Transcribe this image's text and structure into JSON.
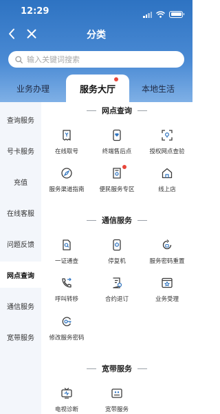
{
  "status": {
    "time": "12:29"
  },
  "nav": {
    "title": "分类"
  },
  "search": {
    "placeholder": "输入关键词搜索"
  },
  "tabs": [
    {
      "label": "业务办理",
      "active": false
    },
    {
      "label": "服务大厅",
      "active": true,
      "dot": true
    },
    {
      "label": "本地生活",
      "active": false
    }
  ],
  "sidebar": {
    "items": [
      {
        "label": "查询服务"
      },
      {
        "label": "号卡服务"
      },
      {
        "label": "充值"
      },
      {
        "label": "在线客服"
      },
      {
        "label": "问题反馈"
      },
      {
        "label": "网点查询",
        "active": true
      },
      {
        "label": "通信服务"
      },
      {
        "label": "宽带服务"
      }
    ]
  },
  "sections": [
    {
      "title": "网点查询",
      "items": [
        {
          "label": "在线取号",
          "icon": "ticket-icon"
        },
        {
          "label": "终端售后点",
          "icon": "phone-heart-icon"
        },
        {
          "label": "授权网点查验",
          "icon": "scan-location-icon"
        },
        {
          "label": "服务渠道指南",
          "icon": "compass-icon"
        },
        {
          "label": "便民服务专区",
          "icon": "location-document-icon",
          "dot": true
        },
        {
          "label": "线上店",
          "icon": "home-icon"
        }
      ]
    },
    {
      "title": "通信服务",
      "items": [
        {
          "label": "一证通查",
          "icon": "search-document-icon"
        },
        {
          "label": "停复机",
          "icon": "phone-power-icon"
        },
        {
          "label": "服务密码重置",
          "icon": "lock-reset-icon"
        },
        {
          "label": "呼叫转移",
          "icon": "call-forward-icon"
        },
        {
          "label": "合约退订",
          "icon": "contract-icon"
        },
        {
          "label": "业务受理",
          "icon": "star-window-icon"
        },
        {
          "label": "修改服务密码",
          "icon": "key-icon"
        }
      ]
    },
    {
      "title": "宽带服务",
      "items": [
        {
          "label": "电视诊断",
          "icon": "tv-icon"
        },
        {
          "label": "宽带服务",
          "icon": "router-icon"
        }
      ]
    }
  ],
  "colors": {
    "header": "#2e73c2",
    "accent": "#2f74c0",
    "dot": "#e8463a"
  }
}
